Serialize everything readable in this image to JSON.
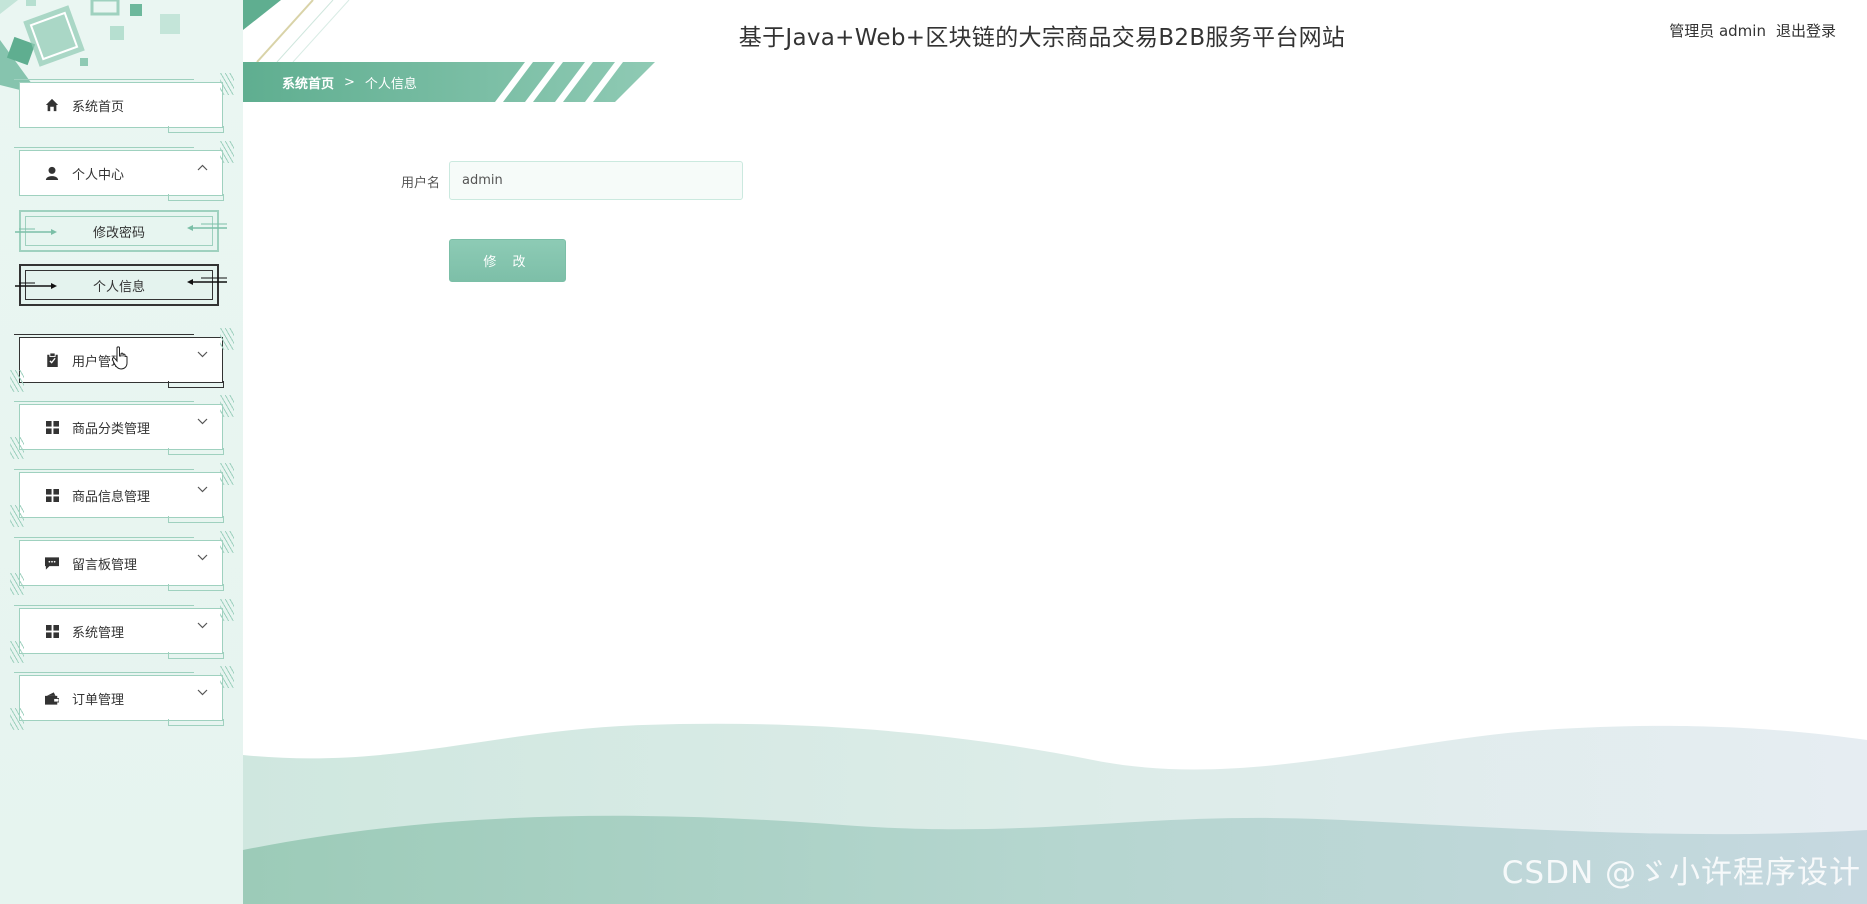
{
  "header": {
    "title": "基于Java+Web+区块链的大宗商品交易B2B服务平台网站",
    "user_label": "管理员 admin",
    "logout_label": "退出登录"
  },
  "breadcrumb": {
    "home": "系统首页",
    "separator": ">",
    "current": "个人信息"
  },
  "sidebar": {
    "items": [
      {
        "label": "系统首页",
        "icon": "home-icon"
      },
      {
        "label": "个人中心",
        "icon": "user-icon",
        "expanded": true
      },
      {
        "label": "用户管理",
        "icon": "clipboard-icon"
      },
      {
        "label": "商品分类管理",
        "icon": "grid-icon"
      },
      {
        "label": "商品信息管理",
        "icon": "grid-icon"
      },
      {
        "label": "留言板管理",
        "icon": "message-icon"
      },
      {
        "label": "系统管理",
        "icon": "grid-icon"
      },
      {
        "label": "订单管理",
        "icon": "wallet-icon"
      }
    ],
    "subitems": [
      {
        "label": "修改密码"
      },
      {
        "label": "个人信息",
        "active": true
      }
    ]
  },
  "form": {
    "username_label": "用户名",
    "username_value": "admin",
    "submit_label": "修 改"
  },
  "watermark": "CSDN @ゞ小许程序设计",
  "colors": {
    "accent": "#5fae90",
    "accent_light": "#9fd1bf",
    "sidebar_bg": "#eaf6f2"
  }
}
